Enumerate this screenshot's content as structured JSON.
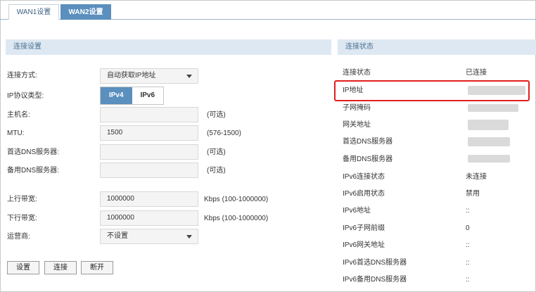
{
  "tabs": [
    {
      "label": "WAN1设置",
      "active": false
    },
    {
      "label": "WAN2设置",
      "active": true
    }
  ],
  "left": {
    "section_title": "连接设置",
    "conn_type": {
      "label": "连接方式:",
      "value": "自动获取IP地址"
    },
    "ip_proto": {
      "label": "IP协议类型:",
      "options": [
        "IPv4",
        "IPv6"
      ],
      "selected": "IPv4"
    },
    "hostname": {
      "label": "主机名:",
      "value": "",
      "hint": "(可选)"
    },
    "mtu": {
      "label": "MTU:",
      "value": "1500",
      "hint": "(576-1500)"
    },
    "dns1": {
      "label": "首选DNS服务器:",
      "value": "",
      "hint": "(可选)"
    },
    "dns2": {
      "label": "备用DNS服务器:",
      "value": "",
      "hint": "(可选)"
    },
    "upload": {
      "label": "上行带宽:",
      "value": "1000000",
      "hint": "Kbps (100-1000000)"
    },
    "download": {
      "label": "下行带宽:",
      "value": "1000000",
      "hint": "Kbps (100-1000000)"
    },
    "isp": {
      "label": "运营商:",
      "value": "不设置"
    },
    "buttons": {
      "set": "设置",
      "connect": "连接",
      "disconnect": "断开"
    }
  },
  "right": {
    "section_title": "连接状态",
    "rows": [
      {
        "label": "连接状态",
        "value": "已连接"
      },
      {
        "label": "IP地址",
        "value": ""
      },
      {
        "label": "子网掩码",
        "value": ""
      },
      {
        "label": "网关地址",
        "value": ""
      },
      {
        "label": "首选DNS服务器",
        "value": ""
      },
      {
        "label": "备用DNS服务器",
        "value": ""
      },
      {
        "label": "IPv6连接状态",
        "value": "未连接"
      },
      {
        "label": "IPv6启用状态",
        "value": "禁用"
      },
      {
        "label": "IPv6地址",
        "value": "::"
      },
      {
        "label": "IPv6子网前缀",
        "value": "0"
      },
      {
        "label": "IPv6网关地址",
        "value": "::"
      },
      {
        "label": "IPv6首选DNS服务器",
        "value": "::"
      },
      {
        "label": "IPv6备用DNS服务器",
        "value": "::"
      }
    ],
    "highlight_color": "#e0201c"
  },
  "colors": {
    "accent": "#5a8fbe",
    "section_bg": "#dde8f2"
  }
}
